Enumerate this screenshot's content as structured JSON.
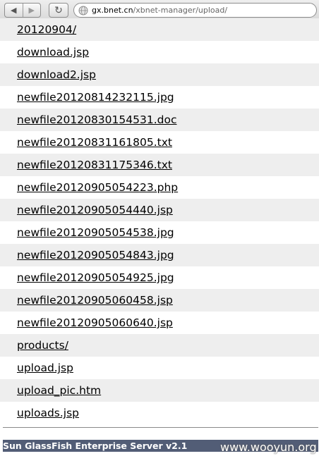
{
  "browser": {
    "back_icon": "back-arrow-icon",
    "forward_icon": "forward-arrow-icon",
    "reload_icon": "reload-icon",
    "site_icon": "globe-icon",
    "url_host": "gx.bnet.cn",
    "url_path": "/xbnet-manager/upload/"
  },
  "listing": {
    "entries": [
      "20120904/",
      "download.jsp",
      "download2.jsp",
      "newfile20120814232115.jpg",
      "newfile20120830154531.doc",
      "newfile20120831161805.txt",
      "newfile20120831175346.txt",
      "newfile20120905054223.php",
      "newfile20120905054440.jsp",
      "newfile20120905054538.jpg",
      "newfile20120905054843.jpg",
      "newfile20120905054925.jpg",
      "newfile20120905060458.jsp",
      "newfile20120905060640.jsp",
      "products/",
      "upload.jsp",
      "upload_pic.htm",
      "uploads.jsp"
    ]
  },
  "footer": {
    "server": "Sun GlassFish Enterprise Server v2.1"
  },
  "watermark": {
    "text": "www.wooyun.org"
  },
  "colors": {
    "row_alt": "#eeeeee",
    "footer_bg": "#525d76"
  }
}
